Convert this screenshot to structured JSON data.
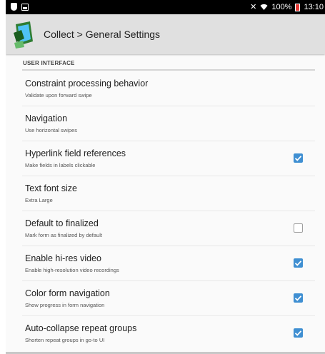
{
  "status_bar": {
    "battery": "100%",
    "time": "13:10",
    "icons": [
      "shield-icon",
      "image-icon",
      "mute-icon",
      "wifi-icon",
      "battery-icon"
    ]
  },
  "app_bar": {
    "title": "Collect > General Settings",
    "logo": "collect-logo-icon"
  },
  "section": {
    "header": "USER INTERFACE"
  },
  "preferences": [
    {
      "title": "Constraint processing behavior",
      "summary": "Validate upon forward swipe",
      "checkbox": null
    },
    {
      "title": "Navigation",
      "summary": "Use horizontal swipes",
      "checkbox": null
    },
    {
      "title": "Hyperlink field references",
      "summary": "Make fields in labels clickable",
      "checkbox": true
    },
    {
      "title": "Text font size",
      "summary": "Extra Large",
      "checkbox": null
    },
    {
      "title": "Default to finalized",
      "summary": "Mark form as finalized by default",
      "checkbox": false
    },
    {
      "title": "Enable hi-res video",
      "summary": "Enable high-resolution video recordings",
      "checkbox": true
    },
    {
      "title": "Color form navigation",
      "summary": "Show progress in form navigation",
      "checkbox": true
    },
    {
      "title": "Auto-collapse repeat groups",
      "summary": "Shorten repeat groups in go-to UI",
      "checkbox": true
    }
  ],
  "colors": {
    "accent": "#3f8fd2",
    "app_bar": "#e0e0e0",
    "status_bar": "#000000"
  }
}
